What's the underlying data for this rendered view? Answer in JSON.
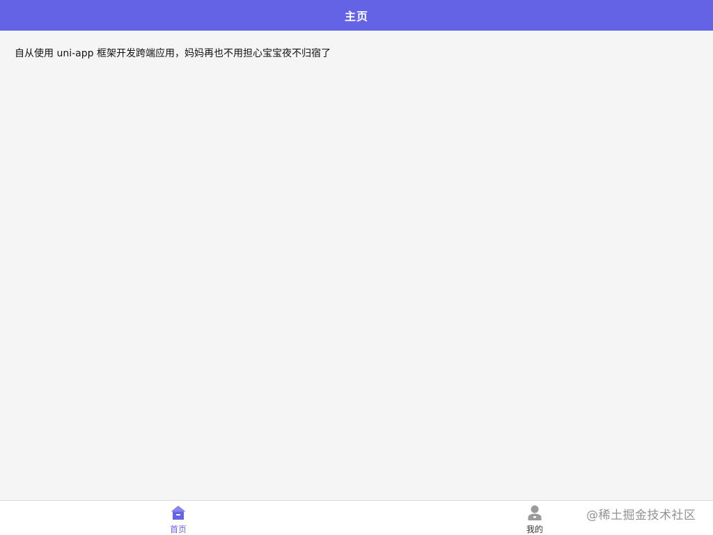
{
  "navbar": {
    "title": "主页"
  },
  "content": {
    "text": "自从使用 uni-app 框架开发跨端应用，妈妈再也不用担心宝宝夜不归宿了"
  },
  "tabbar": {
    "items": [
      {
        "label": "首页",
        "icon": "home-icon",
        "active": true
      },
      {
        "label": "我的",
        "icon": "user-icon",
        "active": false
      }
    ]
  },
  "colors": {
    "accent": "#6463e6",
    "background": "#f5f5f5",
    "tab_inactive_icon": "#9a9a9a"
  },
  "watermark": {
    "text": "@稀土掘金技术社区"
  }
}
